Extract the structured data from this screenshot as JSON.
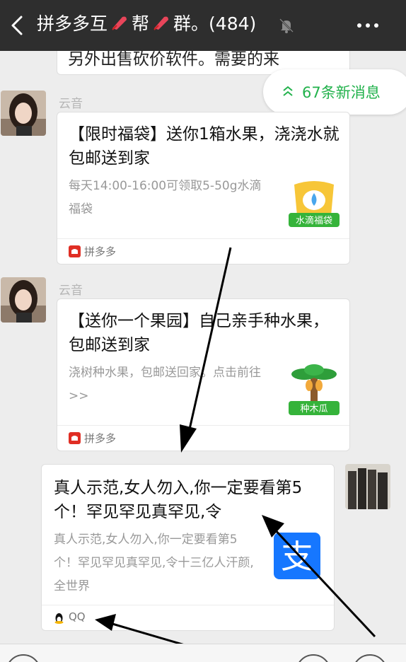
{
  "header": {
    "title_part1": "拼多多互",
    "title_part2": "帮",
    "title_part3": "群。(484)",
    "back_icon": "chevron-left-icon",
    "mute_icon": "bell-muted-icon",
    "more_icon": "more-dots-icon"
  },
  "previous_message": {
    "text": "另外出售砍价软件。需要的来"
  },
  "new_messages": {
    "label": "67条新消息",
    "icon": "double-chevron-up-icon",
    "color": "#22b24c"
  },
  "messages": [
    {
      "sender": "云音",
      "card": {
        "title": "【限时福袋】送你1箱水果，浇浇水就包邮送到家",
        "desc": "每天14:00-16:00可领取5-50g水滴福袋",
        "thumb_label": "水滴福袋",
        "source": "拼多多"
      }
    },
    {
      "sender": "云音",
      "card": {
        "title": "【送你一个果园】自己亲手种水果，包邮送到家",
        "desc": "浇树种水果，包邮送回家。点击前往>>",
        "thumb_label": "种木瓜",
        "source": "拼多多"
      }
    },
    {
      "sender": "",
      "card": {
        "title": "真人示范,女人勿入,你一定要看第5个！罕见罕见真罕见,令",
        "desc": "真人示范,女人勿入,你一定要看第5个！罕见罕见真罕见,令十三亿人汗颜,全世界",
        "thumb_label": "",
        "source": "QQ"
      }
    }
  ],
  "colors": {
    "header_bg": "#2e2e2e",
    "chat_bg": "#ededed",
    "accent_green": "#22b24c",
    "pdd_red": "#e02e24",
    "alipay_blue": "#1677ff"
  }
}
